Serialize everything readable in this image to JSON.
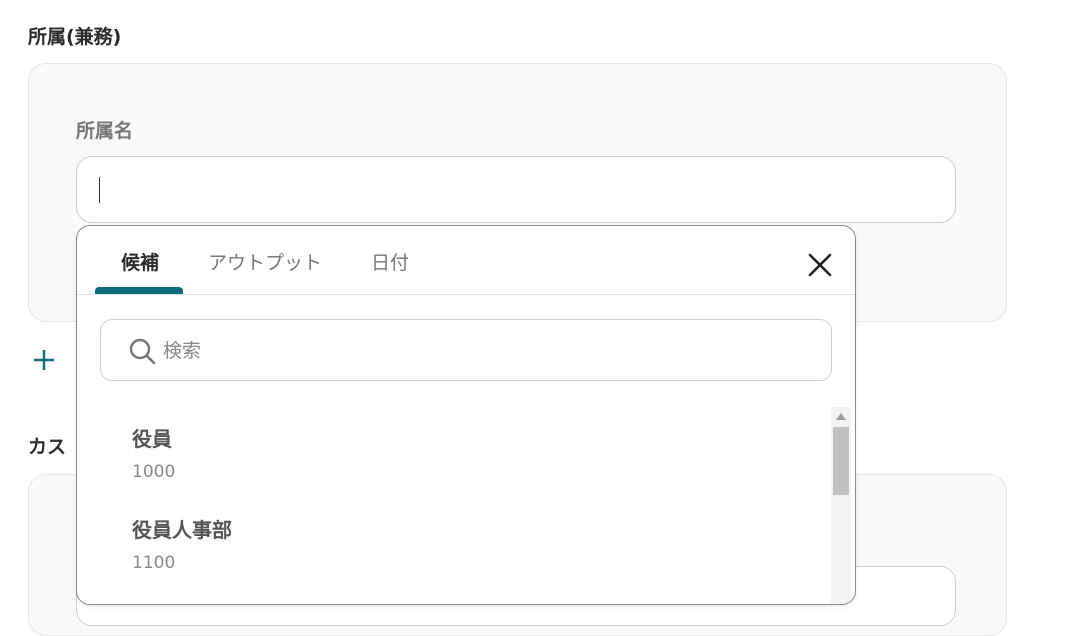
{
  "sections": {
    "affiliation_title": "所属(兼務)",
    "custom_title_partial": "カス",
    "add_partial": "",
    "affiliation_field_label": "所属名"
  },
  "affiliation_input": {
    "value": "",
    "placeholder": ""
  },
  "dropdown": {
    "tabs": [
      {
        "label": "候補",
        "active": true
      },
      {
        "label": "アウトプット",
        "active": false
      },
      {
        "label": "日付",
        "active": false
      }
    ],
    "close_icon": "close-icon",
    "search": {
      "placeholder": "検索",
      "value": "",
      "icon": "search-icon"
    },
    "items": [
      {
        "name": "役員",
        "code": "1000"
      },
      {
        "name": "役員人事部",
        "code": "1100"
      }
    ]
  },
  "colors": {
    "accent": "#0f6c7c",
    "card_bg": "#fafafa",
    "border": "#d0d0d0"
  }
}
